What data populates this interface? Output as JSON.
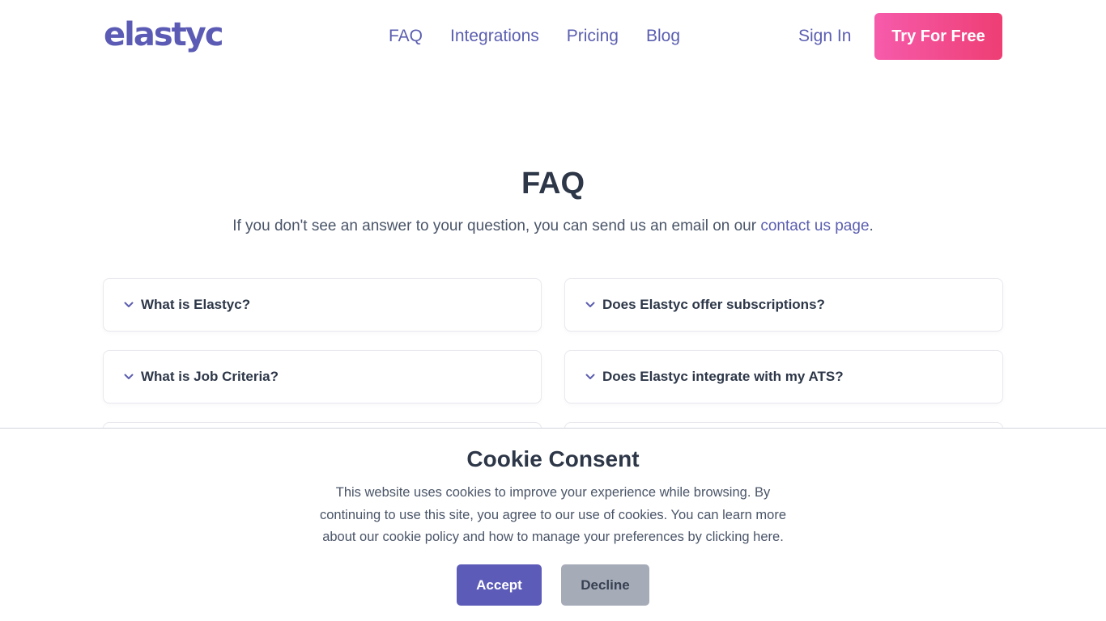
{
  "header": {
    "logo": "elastyc",
    "nav": [
      "FAQ",
      "Integrations",
      "Pricing",
      "Blog"
    ],
    "sign_in": "Sign In",
    "cta": "Try For Free"
  },
  "faq": {
    "title": "FAQ",
    "subtitle_prefix": "If you don't see an answer to your question, you can send us an email on our ",
    "subtitle_link": "contact us page",
    "subtitle_suffix": ".",
    "questions": [
      "What is Elastyc?",
      "Does Elastyc offer subscriptions?",
      "What is Job Criteria?",
      "Does Elastyc integrate with my ATS?"
    ]
  },
  "cookie": {
    "title": "Cookie Consent",
    "text": "This website uses cookies to improve your experience while browsing. By continuing to use this site, you agree to our use of cookies. You can learn more about our cookie policy and how to manage your preferences by clicking ",
    "link": "here",
    "text_suffix": ".",
    "accept": "Accept",
    "decline": "Decline"
  },
  "colors": {
    "brand": "#5b5bb5",
    "cta_start": "#f65bab",
    "cta_end": "#ee3e74",
    "accept": "#5c5bb8",
    "decline": "#a6abb8"
  },
  "icons": [
    "chevron-down-icon"
  ]
}
